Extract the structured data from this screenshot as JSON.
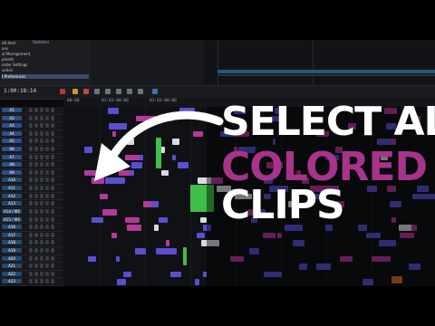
{
  "project_panel": {
    "statistics_label": "Statistics",
    "menu_items": [
      {
        "label": "dit Item",
        "selected": false
      },
      {
        "label": "ons",
        "selected": false
      },
      {
        "label": "al Management",
        "selected": false
      },
      {
        "label": "pment",
        "selected": false
      },
      {
        "label": "order Settings",
        "selected": false
      },
      {
        "label": "uction",
        "selected": false
      },
      {
        "label": "t Preferences",
        "selected": true
      }
    ]
  },
  "toolbar": {
    "timecode": "1:00:18:14"
  },
  "ruler": {
    "timecodes": [
      "00:00",
      "01:01:00:00",
      "01:02:00:00"
    ]
  },
  "tracks": [
    {
      "label": "A1",
      "type": "video"
    },
    {
      "label": "A2",
      "type": "video"
    },
    {
      "label": "A3",
      "type": "video"
    },
    {
      "label": "A4",
      "type": "video"
    },
    {
      "label": "A5",
      "type": "video"
    },
    {
      "label": "A6",
      "type": "video"
    },
    {
      "label": "A7",
      "type": "video"
    },
    {
      "label": "A8",
      "type": "video"
    },
    {
      "label": "A9",
      "type": "video"
    },
    {
      "label": "A10",
      "type": "audio"
    },
    {
      "label": "A11",
      "type": "audio"
    },
    {
      "label": "A12",
      "type": "audio"
    },
    {
      "label": "A13",
      "type": "audio"
    },
    {
      "label": "A14 / MX",
      "type": "audio"
    },
    {
      "label": "A15 / MX",
      "type": "audio"
    },
    {
      "label": "A16",
      "type": "audio"
    },
    {
      "label": "A17",
      "type": "audio"
    },
    {
      "label": "A18",
      "type": "audio"
    },
    {
      "label": "A19",
      "type": "audio"
    },
    {
      "label": "A20",
      "type": "audio"
    },
    {
      "label": "A21",
      "type": "audio"
    },
    {
      "label": "A22",
      "type": "audio"
    },
    {
      "label": "A23",
      "type": "audio"
    }
  ],
  "overlay": {
    "line1": "SELECT ALL",
    "line2": "COLORED",
    "line3": "CLIPS",
    "accent_color": "#a7338a",
    "arrow_icon": "curved-arrow-left"
  },
  "colors": {
    "clip_purple": "#5a4fd0",
    "clip_magenta": "#b33a9a",
    "clip_green": "#3fbf4a",
    "clip_white": "#d9d9e2",
    "clip_orange": "#c9722c"
  }
}
